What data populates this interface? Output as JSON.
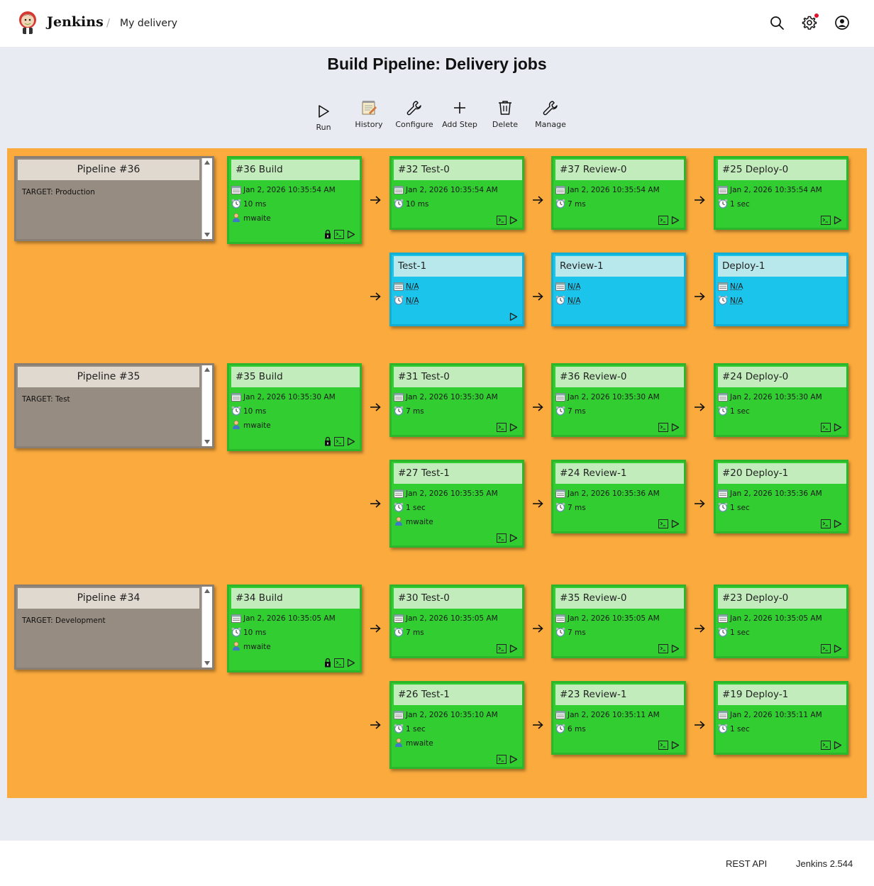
{
  "header": {
    "brand": "Jenkins",
    "breadcrumb_separator": "/",
    "breadcrumb": "My delivery",
    "icons": [
      "search-icon",
      "settings-gear-icon",
      "user-account-icon"
    ],
    "notification_dot_color": "#e0102a"
  },
  "page_title": "Build Pipeline: Delivery jobs",
  "toolbar": [
    {
      "label": "Run",
      "icon": "play-icon"
    },
    {
      "label": "History",
      "icon": "notepad-icon"
    },
    {
      "label": "Configure",
      "icon": "wrench-icon"
    },
    {
      "label": "Add Step",
      "icon": "plus-icon"
    },
    {
      "label": "Delete",
      "icon": "trash-icon"
    },
    {
      "label": "Manage",
      "icon": "wrench-icon"
    }
  ],
  "colors": {
    "area": "#fbab3d",
    "success": "#31cd31",
    "pending": "#1bc4ea",
    "pipeline_box": "#978c81"
  },
  "pipelines": [
    {
      "title": "Pipeline #36",
      "target": "TARGET: Production",
      "build": {
        "title": "#36 Build",
        "date": "Jan 2, 2026 10:35:54 AM",
        "duration": "10 ms",
        "user": "mwaite"
      },
      "rows": [
        [
          {
            "title": "#32 Test-0",
            "date": "Jan 2, 2026 10:35:54 AM",
            "duration": "10 ms",
            "status": "success"
          },
          {
            "title": "#37 Review-0",
            "date": "Jan 2, 2026 10:35:54 AM",
            "duration": "7 ms",
            "status": "success"
          },
          {
            "title": "#25 Deploy-0",
            "date": "Jan 2, 2026 10:35:54 AM",
            "duration": "1 sec",
            "status": "success"
          }
        ],
        [
          {
            "title": "Test-1",
            "date": "N/A",
            "duration": "N/A",
            "status": "pending",
            "runnable": true
          },
          {
            "title": "Review-1",
            "date": "N/A",
            "duration": "N/A",
            "status": "pending"
          },
          {
            "title": "Deploy-1",
            "date": "N/A",
            "duration": "N/A",
            "status": "pending"
          }
        ]
      ]
    },
    {
      "title": "Pipeline #35",
      "target": "TARGET: Test",
      "build": {
        "title": "#35 Build",
        "date": "Jan 2, 2026 10:35:30 AM",
        "duration": "10 ms",
        "user": "mwaite"
      },
      "rows": [
        [
          {
            "title": "#31 Test-0",
            "date": "Jan 2, 2026 10:35:30 AM",
            "duration": "7 ms",
            "status": "success"
          },
          {
            "title": "#36 Review-0",
            "date": "Jan 2, 2026 10:35:30 AM",
            "duration": "7 ms",
            "status": "success"
          },
          {
            "title": "#24 Deploy-0",
            "date": "Jan 2, 2026 10:35:30 AM",
            "duration": "1 sec",
            "status": "success"
          }
        ],
        [
          {
            "title": "#27 Test-1",
            "date": "Jan 2, 2026 10:35:35 AM",
            "duration": "1 sec",
            "user": "mwaite",
            "status": "success"
          },
          {
            "title": "#24 Review-1",
            "date": "Jan 2, 2026 10:35:36 AM",
            "duration": "7 ms",
            "status": "success"
          },
          {
            "title": "#20 Deploy-1",
            "date": "Jan 2, 2026 10:35:36 AM",
            "duration": "1 sec",
            "status": "success"
          }
        ]
      ]
    },
    {
      "title": "Pipeline #34",
      "target": "TARGET: Development",
      "build": {
        "title": "#34 Build",
        "date": "Jan 2, 2026 10:35:05 AM",
        "duration": "10 ms",
        "user": "mwaite"
      },
      "rows": [
        [
          {
            "title": "#30 Test-0",
            "date": "Jan 2, 2026 10:35:05 AM",
            "duration": "7 ms",
            "status": "success"
          },
          {
            "title": "#35 Review-0",
            "date": "Jan 2, 2026 10:35:05 AM",
            "duration": "7 ms",
            "status": "success"
          },
          {
            "title": "#23 Deploy-0",
            "date": "Jan 2, 2026 10:35:05 AM",
            "duration": "1 sec",
            "status": "success"
          }
        ],
        [
          {
            "title": "#26 Test-1",
            "date": "Jan 2, 2026 10:35:10 AM",
            "duration": "1 sec",
            "user": "mwaite",
            "status": "success"
          },
          {
            "title": "#23 Review-1",
            "date": "Jan 2, 2026 10:35:11 AM",
            "duration": "6 ms",
            "status": "success"
          },
          {
            "title": "#19 Deploy-1",
            "date": "Jan 2, 2026 10:35:11 AM",
            "duration": "1 sec",
            "status": "success"
          }
        ]
      ]
    }
  ],
  "footer": {
    "rest_api": "REST API",
    "version": "Jenkins 2.544"
  }
}
